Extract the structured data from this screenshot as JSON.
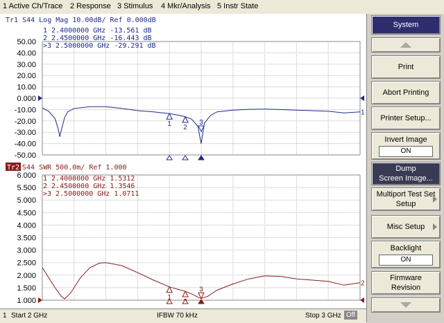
{
  "menu": [
    "1 Active Ch/Trace",
    "2 Response",
    "3 Stimulus",
    "4 Mkr/Analysis",
    "5 Instr State"
  ],
  "trace1": {
    "header": "Tr1  S44  Log Mag  10.00dB/ Ref  0.000dB",
    "markers_text": [
      " 1   2.4000000  GHz  -13.561  dB",
      " 2   2.4500000  GHz  -16.443  dB",
      ">3   2.5000000  GHz  -29.291  dB"
    ],
    "color": "#1a2a8a"
  },
  "trace2": {
    "tag": "Tr2",
    "header": " S44  SWR  500.0m/ Ref  1.000",
    "markers_text": [
      " 1   2.4000000  GHz   1.5312",
      " 2   2.4500000  GHz   1.3546",
      ">3   2.5000000  GHz   1.0711"
    ],
    "color": "#8a1a1a"
  },
  "chart_data": [
    {
      "type": "line",
      "title": "Tr1 S44 Log Mag 10.00dB/ Ref 0.000dB",
      "ylabel": "dB",
      "ylim": [
        -50,
        50
      ],
      "yticks": [
        "50.00",
        "40.00",
        "30.00",
        "20.00",
        "10.00",
        "0.000",
        "-10.00",
        "-20.00",
        "-30.00",
        "-40.00",
        "-50.00"
      ],
      "xlim": [
        2,
        3
      ],
      "x": [
        2.0,
        2.02,
        2.04,
        2.05,
        2.055,
        2.06,
        2.07,
        2.08,
        2.1,
        2.15,
        2.2,
        2.25,
        2.3,
        2.35,
        2.4,
        2.43,
        2.45,
        2.47,
        2.49,
        2.495,
        2.5,
        2.505,
        2.51,
        2.53,
        2.55,
        2.6,
        2.65,
        2.7,
        2.75,
        2.8,
        2.85,
        2.9,
        2.95,
        3.0
      ],
      "series": [
        {
          "values": [
            -8.5,
            -11.5,
            -18,
            -27,
            -34,
            -28,
            -17,
            -12,
            -9,
            -7.5,
            -7.5,
            -9,
            -11,
            -12,
            -13.6,
            -15,
            -16.4,
            -18.5,
            -25,
            -33,
            -40,
            -31,
            -22,
            -15,
            -12,
            -10.5,
            -9.8,
            -9.6,
            -10,
            -10.5,
            -11,
            -11.5,
            -13,
            -12
          ]
        }
      ],
      "markers": [
        {
          "label": "1",
          "x": 2.4,
          "y": -13.561
        },
        {
          "label": "2",
          "x": 2.45,
          "y": -16.443
        },
        {
          "label": "3",
          "x": 2.5,
          "y": -29.291
        }
      ],
      "end_label": "1"
    },
    {
      "type": "line",
      "title": "Tr2 S44 SWR 500.0m/ Ref 1.000",
      "ylabel": "SWR",
      "ylim": [
        1,
        6
      ],
      "yticks": [
        "6.000",
        "5.500",
        "5.000",
        "4.500",
        "4.000",
        "3.500",
        "3.000",
        "2.500",
        "2.000",
        "1.500",
        "1.000"
      ],
      "xlim": [
        2,
        3
      ],
      "x": [
        2.0,
        2.02,
        2.04,
        2.06,
        2.07,
        2.09,
        2.12,
        2.15,
        2.18,
        2.2,
        2.25,
        2.3,
        2.35,
        2.4,
        2.45,
        2.47,
        2.49,
        2.5,
        2.52,
        2.55,
        2.6,
        2.65,
        2.7,
        2.75,
        2.8,
        2.85,
        2.9,
        2.95,
        3.0
      ],
      "series": [
        {
          "values": [
            2.3,
            1.9,
            1.5,
            1.15,
            1.05,
            1.3,
            1.9,
            2.3,
            2.48,
            2.5,
            2.38,
            2.1,
            1.8,
            1.53,
            1.35,
            1.25,
            1.12,
            1.07,
            1.15,
            1.4,
            1.65,
            1.85,
            1.97,
            1.95,
            1.85,
            1.8,
            1.75,
            1.6,
            1.7
          ]
        }
      ],
      "markers": [
        {
          "label": "1",
          "x": 2.4,
          "y": 1.5312
        },
        {
          "label": "2",
          "x": 2.45,
          "y": 1.3546
        },
        {
          "label": "3",
          "x": 2.5,
          "y": 1.0711
        }
      ],
      "end_label": "2"
    }
  ],
  "status": {
    "channel": "1",
    "start": "Start 2 GHz",
    "ifbw": "IFBW 70 kHz",
    "stop": "Stop 3 GHz",
    "off": "Off"
  },
  "softkeys": {
    "title": "System",
    "print": "Print",
    "abort": "Abort Printing",
    "printer_setup": "Printer Setup...",
    "invert_image": "Invert Image",
    "invert_state": "ON",
    "dump_line1": "Dump",
    "dump_line2": "Screen Image...",
    "multiport_line1": "Multiport Test Set",
    "multiport_line2": "Setup",
    "misc": "Misc Setup",
    "backlight": "Backlight",
    "backlight_state": "ON",
    "firmware_line1": "Firmware",
    "firmware_line2": "Revision"
  },
  "colors": {
    "grid": "#b8b8b8",
    "trace1": "#1a2a8a",
    "trace2": "#8a1a1a"
  }
}
